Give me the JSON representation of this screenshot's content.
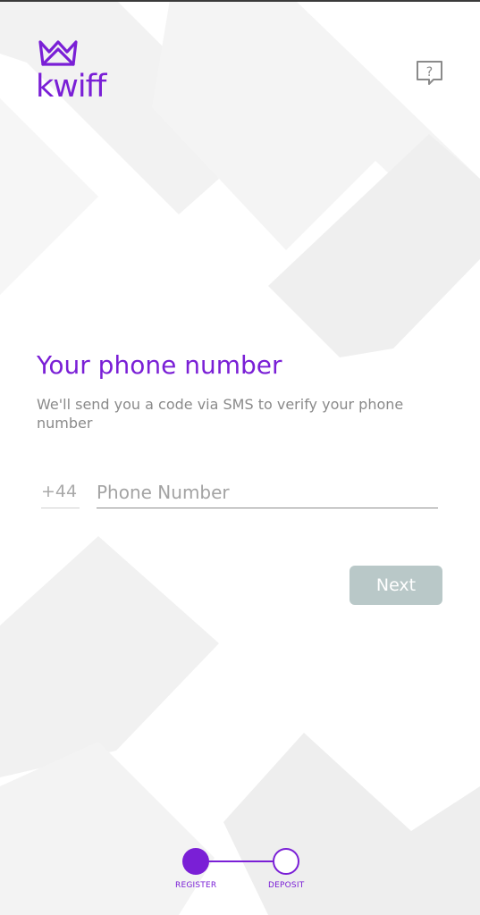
{
  "brand": {
    "name": "kwiff",
    "color": "#7a1fd6",
    "logo_icon": "crown-icon"
  },
  "header": {
    "help_icon": "help-chat-icon",
    "help_glyph": "?"
  },
  "main": {
    "title": "Your phone number",
    "subtitle": "We'll send you a code via SMS to verify your phone number",
    "country_code": "+44",
    "phone_placeholder": "Phone Number",
    "phone_value": "",
    "next_label": "Next",
    "next_color": "#b9c8c8"
  },
  "steps": {
    "items": [
      {
        "label": "REGISTER",
        "state": "active"
      },
      {
        "label": "DEPOSIT",
        "state": "inactive"
      }
    ]
  }
}
